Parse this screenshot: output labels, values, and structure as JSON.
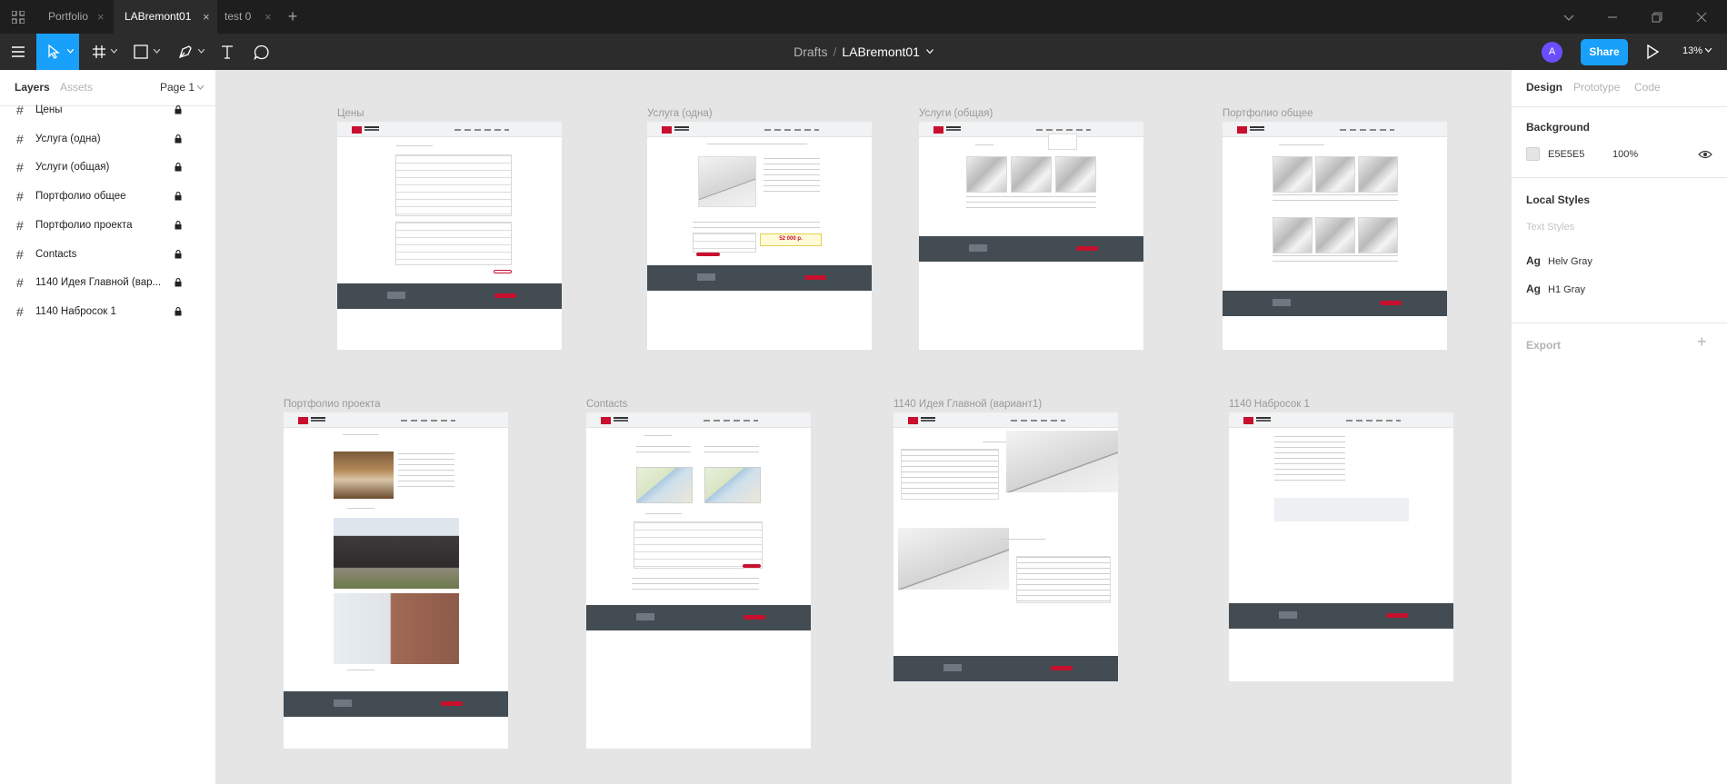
{
  "tabs": [
    {
      "label": "Portfolio",
      "active": false
    },
    {
      "label": "LABremont01",
      "active": true
    },
    {
      "label": "test 0",
      "active": false
    }
  ],
  "toolbar": {
    "breadcrumb_parent": "Drafts",
    "breadcrumb_separator": "/",
    "file_name": "LABremont01",
    "avatar_initial": "A",
    "share_label": "Share",
    "zoom": "13%",
    "active_tool": "move"
  },
  "left_panel": {
    "tab_layers": "Layers",
    "tab_assets": "Assets",
    "page": "Page 1",
    "layers": [
      {
        "label": "Цены",
        "locked": true
      },
      {
        "label": "Услуга (одна)",
        "locked": true
      },
      {
        "label": "Услуги (общая)",
        "locked": true
      },
      {
        "label": "Портфолио общее",
        "locked": true
      },
      {
        "label": "Портфолио проекта",
        "locked": true
      },
      {
        "label": "Contacts",
        "locked": true
      },
      {
        "label": "1140 Идея Главной (вар...",
        "locked": true
      },
      {
        "label": "1140 Набросок 1",
        "locked": true
      }
    ]
  },
  "right_panel": {
    "tab_design": "Design",
    "tab_prototype": "Prototype",
    "tab_code": "Code",
    "background_title": "Background",
    "background_hex": "E5E5E5",
    "background_opacity": "100%",
    "local_styles_title": "Local Styles",
    "text_styles_label": "Text Styles",
    "styles": [
      {
        "prefix": "Ag",
        "name": "Helv Gray"
      },
      {
        "prefix": "Ag",
        "name": "H1 Gray"
      }
    ],
    "export_title": "Export"
  },
  "canvas": {
    "frames": [
      {
        "label": "Цены"
      },
      {
        "label": "Услуга (одна)"
      },
      {
        "label": "Услуги (общая)"
      },
      {
        "label": "Портфолио общее"
      },
      {
        "label": "Портфолио проекта"
      },
      {
        "label": "Contacts"
      },
      {
        "label": "1140 Идея Главной (вариант1)"
      },
      {
        "label": "1140 Набросок 1"
      }
    ],
    "price_badge": "52 000 р."
  },
  "colors": {
    "accent": "#18a0fb",
    "brand_red": "#c8102e",
    "footer_dark": "#434c53",
    "canvas_bg": "#e5e5e5"
  }
}
